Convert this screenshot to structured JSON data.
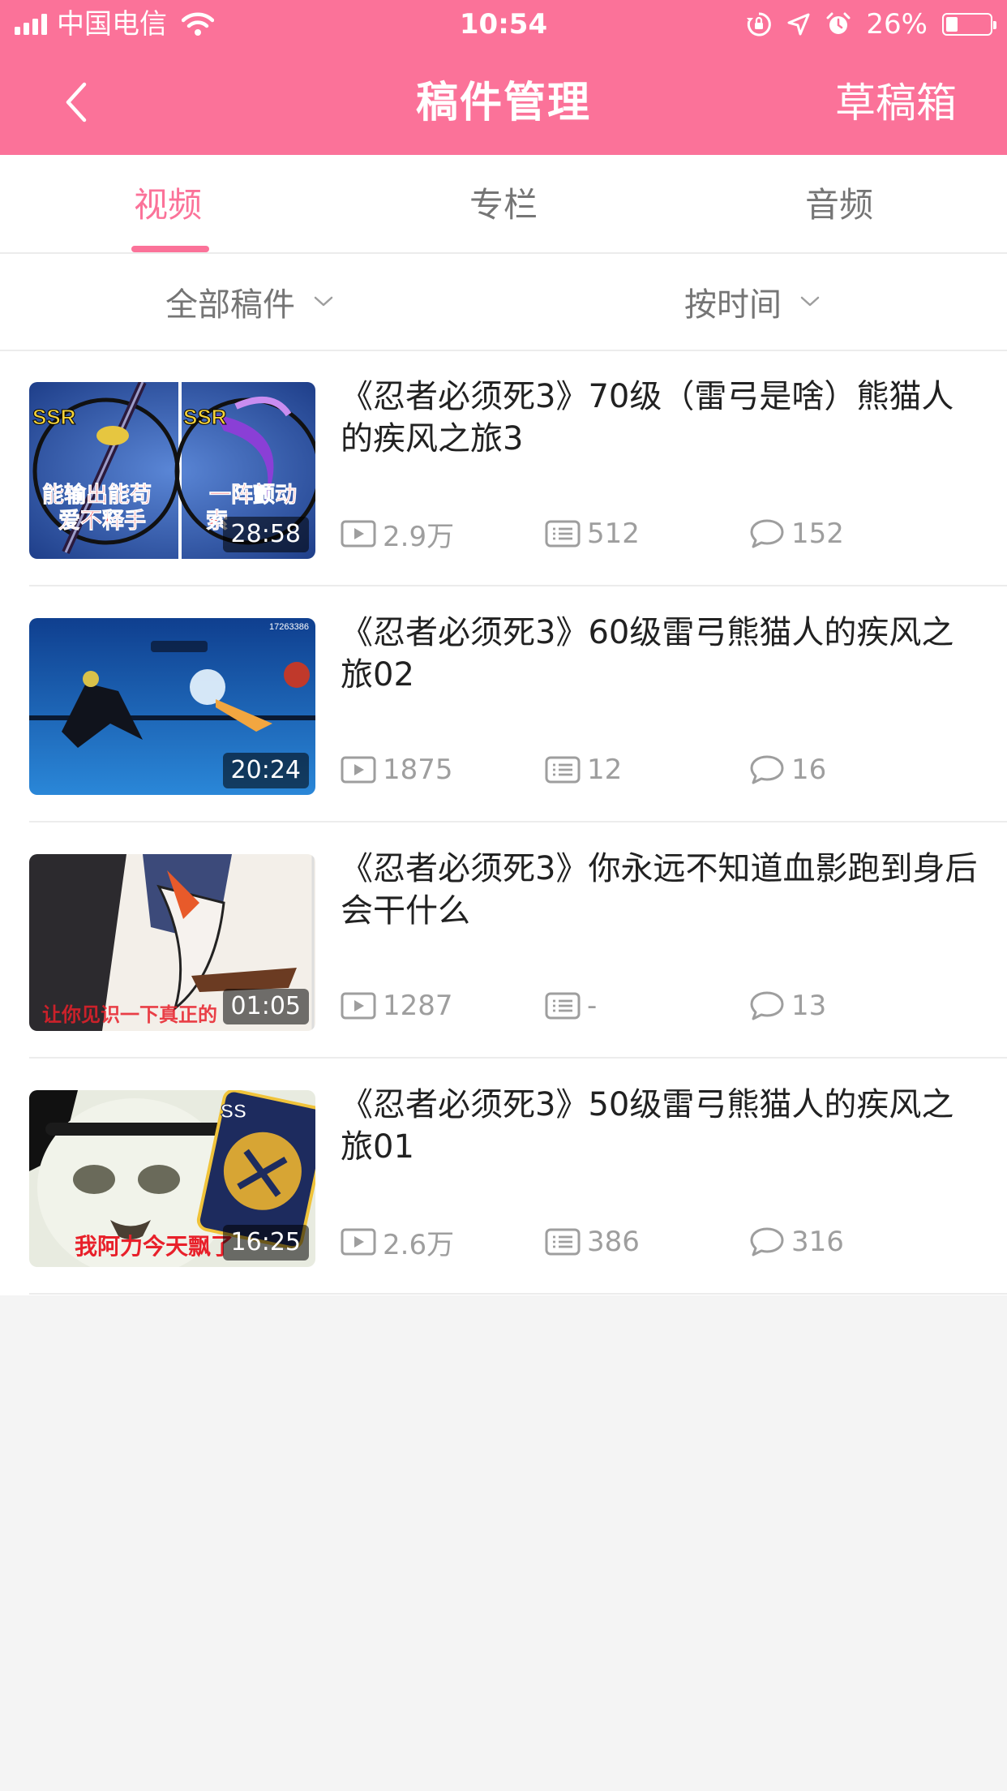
{
  "status_bar": {
    "carrier": "中国电信",
    "time": "10:54",
    "battery": "26%",
    "battery_level": 0.26
  },
  "header": {
    "title": "稿件管理",
    "drafts_label": "草稿箱",
    "background_color": "#fb7299"
  },
  "tabs": [
    {
      "label": "视频",
      "active": true
    },
    {
      "label": "专栏",
      "active": false
    },
    {
      "label": "音频",
      "active": false
    }
  ],
  "filters": {
    "scope": "全部稿件",
    "sort": "按时间"
  },
  "videos": [
    {
      "title": "《忍者必须死3》70级（雷弓是啥）熊猫人的疾风之旅3",
      "duration": "28:58",
      "views": "2.9万",
      "danmaku": "512",
      "comments": "152",
      "thumb_text": [
        "能输出能苟",
        "爱不释手",
        "一阵颤动",
        "索"
      ],
      "thumb_badges": [
        "SSR",
        "SSR"
      ]
    },
    {
      "title": "《忍者必须死3》60级雷弓熊猫人的疾风之旅02",
      "duration": "20:24",
      "views": "1875",
      "danmaku": "12",
      "comments": "16",
      "thumb_text": [
        "17263386"
      ]
    },
    {
      "title": "《忍者必须死3》你永远不知道血影跑到身后会干什么",
      "duration": "01:05",
      "views": "1287",
      "danmaku": "-",
      "comments": "13",
      "thumb_text": [
        "让你见识一下真正的"
      ]
    },
    {
      "title": "《忍者必须死3》50级雷弓熊猫人的疾风之旅01",
      "duration": "16:25",
      "views": "2.6万",
      "danmaku": "386",
      "comments": "316",
      "thumb_text": [
        "我阿力今天飘了"
      ],
      "thumb_badges": [
        "SS"
      ]
    }
  ]
}
